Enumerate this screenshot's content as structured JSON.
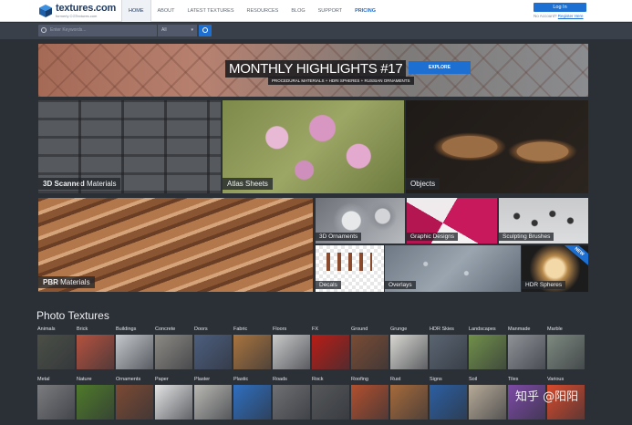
{
  "header": {
    "logo_name": "textures.com",
    "logo_sub": "formerly CGTextures.com",
    "nav": [
      "HOME",
      "ABOUT",
      "LATEST TEXTURES",
      "RESOURCES",
      "BLOG",
      "SUPPORT",
      "PRICING"
    ],
    "login_label": "Log In",
    "no_account": "No Account?",
    "register": "Register Here"
  },
  "search": {
    "placeholder": "Enter Keywords...",
    "scope": "All"
  },
  "hero": {
    "title": "MONTHLY HIGHLIGHTS #17",
    "subtitle": "PROCEDURAL MATERIALS + HDRI SPHERES + RUSSIAN ORNAMENTS",
    "button": "EXPLORE"
  },
  "tiles": {
    "scanned_bold": "3D Scanned",
    "scanned_rest": " Materials",
    "atlas": "Atlas Sheets",
    "objects": "Objects",
    "pbr_bold": "PBR",
    "pbr_rest": " Materials",
    "ornaments": "3D Ornaments",
    "graphic": "Graphic Designs",
    "sculpt": "Sculpting Brushes",
    "decals": "Decals",
    "overlays": "Overlays",
    "hdr": "HDR Spheres",
    "new_badge": "NEW"
  },
  "photo_textures": {
    "title": "Photo Textures",
    "row1": [
      {
        "name": "Animals",
        "color": "#4b4f46"
      },
      {
        "name": "Brick",
        "color": "#b5523f"
      },
      {
        "name": "Buildings",
        "color": "#c4c7cb"
      },
      {
        "name": "Concrete",
        "color": "#8d8a84"
      },
      {
        "name": "Doors",
        "color": "#4c5e7e"
      },
      {
        "name": "Fabric",
        "color": "#a9743f"
      },
      {
        "name": "Floors",
        "color": "#c9c9c9"
      },
      {
        "name": "FX",
        "color": "#b81d16"
      },
      {
        "name": "Ground",
        "color": "#7a4c34"
      },
      {
        "name": "Grunge",
        "color": "#d8d7d2"
      },
      {
        "name": "HDR Skies",
        "color": "#5a6572"
      },
      {
        "name": "Landscapes",
        "color": "#71904a"
      },
      {
        "name": "Manmade",
        "color": "#8f9398"
      },
      {
        "name": "Marble",
        "color": "#7e8a80"
      }
    ],
    "row2": [
      {
        "name": "Metal",
        "color": "#7b7c7f"
      },
      {
        "name": "Nature",
        "color": "#4f7a2a"
      },
      {
        "name": "Ornaments",
        "color": "#7c4a33"
      },
      {
        "name": "Paper",
        "color": "#e3e3e3"
      },
      {
        "name": "Plaster",
        "color": "#b9b8b3"
      },
      {
        "name": "Plastic",
        "color": "#2f6fc0"
      },
      {
        "name": "Roads",
        "color": "#6f7073"
      },
      {
        "name": "Rock",
        "color": "#56585a"
      },
      {
        "name": "Roofing",
        "color": "#b1502e"
      },
      {
        "name": "Rust",
        "color": "#a66a3b"
      },
      {
        "name": "Signs",
        "color": "#2c5fa2"
      },
      {
        "name": "Soil",
        "color": "#b7ab98"
      },
      {
        "name": "Tiles",
        "color": "#7d4aa6"
      },
      {
        "name": "Various",
        "color": "#d84a2c"
      }
    ]
  },
  "watermark": "知乎 @阳阳"
}
